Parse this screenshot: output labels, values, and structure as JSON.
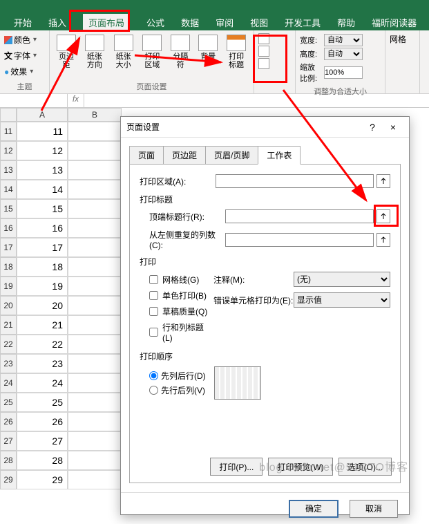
{
  "ribbon": {
    "tabs": [
      "开始",
      "插入",
      "页面布局",
      "公式",
      "数据",
      "审阅",
      "视图",
      "开发工具",
      "帮助",
      "福昕阅读器"
    ],
    "active_tab": "页面布局",
    "theme_group": {
      "color": "颜色",
      "font": "字体",
      "effect": "效果",
      "label": "主题"
    },
    "page_setup": {
      "margin": "页边距",
      "orientation": "纸张方向",
      "size": "纸张大小",
      "print_area": "打印区域",
      "breaks": "分隔符",
      "background": "背景",
      "print_titles": "打印标题",
      "label": "页面设置"
    },
    "scale": {
      "width": "宽度:",
      "height": "高度:",
      "scale": "缩放比例:",
      "auto": "自动",
      "pct": "100%",
      "label": "调整为合适大小"
    },
    "grid": {
      "label": "网格"
    }
  },
  "sheet": {
    "col_headers": [
      "A",
      "B"
    ],
    "rows": [
      11,
      12,
      13,
      14,
      15,
      16,
      17,
      18,
      19,
      20,
      21,
      22,
      23,
      24,
      25,
      26,
      27,
      28,
      29
    ]
  },
  "dialog": {
    "title": "页面设置",
    "help": "?",
    "close": "×",
    "tabs": [
      "页面",
      "页边距",
      "页眉/页脚",
      "工作表"
    ],
    "active_tab": "工作表",
    "print_area_lbl": "打印区域(A):",
    "titles_section": "打印标题",
    "top_rows": "顶端标题行(R):",
    "left_cols": "从左侧重复的列数(C):",
    "print_section": "打印",
    "chk_grid": "网格线(G)",
    "chk_mono": "单色打印(B)",
    "chk_draft": "草稿质量(Q)",
    "chk_rowcol": "行和列标题(L)",
    "anno_lbl": "注释(M):",
    "anno_val": "(无)",
    "err_lbl": "错误单元格打印为(E):",
    "err_val": "显示值",
    "order_section": "打印顺序",
    "rad_down": "先列后行(D)",
    "rad_over": "先行后列(V)",
    "btn_print": "打印(P)...",
    "btn_preview": "打印预览(W)",
    "btn_options": "选项(O)...",
    "btn_ok": "确定",
    "btn_cancel": "取消"
  },
  "watermark": "blog.csdn.net@51CTO博客"
}
